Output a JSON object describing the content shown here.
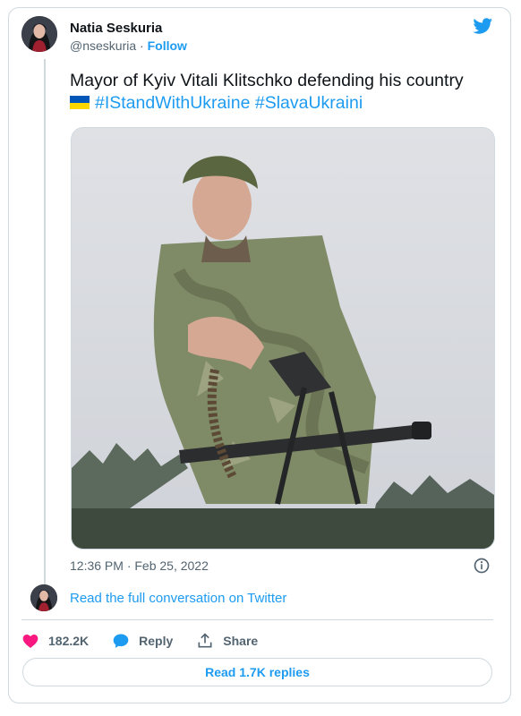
{
  "author": {
    "name": "Natia Seskuria",
    "handle": "@nseskuria",
    "separator": "·",
    "follow_label": "Follow"
  },
  "tweet": {
    "text": "Mayor of Kyiv Vitali Klitschko defending his country",
    "flag_emoji": "ukraine-flag",
    "hashtags": [
      "#IStandWithUkraine",
      "#SlavaUkraini"
    ],
    "timestamp": "12:36 PM · Feb 25, 2022"
  },
  "conversation": {
    "link_label": "Read the full conversation on Twitter"
  },
  "actions": {
    "likes": "182.2K",
    "reply_label": "Reply",
    "share_label": "Share"
  },
  "replies_button": {
    "label": "Read 1.7K replies"
  },
  "colors": {
    "accent": "#1d9bf0",
    "like": "#f91880",
    "muted": "#536471",
    "border": "#cfd9de"
  },
  "icons": [
    "twitter-bird-icon",
    "info-icon",
    "heart-icon",
    "reply-bubble-icon",
    "share-icon"
  ]
}
